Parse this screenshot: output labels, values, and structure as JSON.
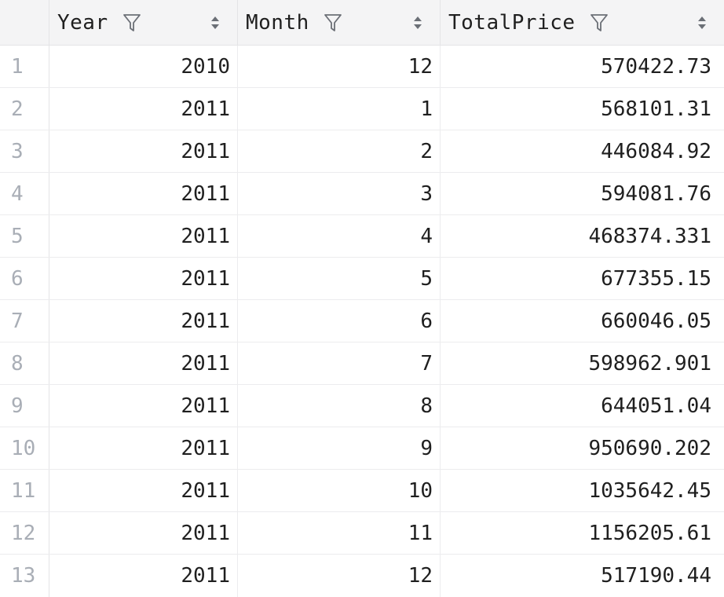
{
  "columns": [
    {
      "label": "Year"
    },
    {
      "label": "Month"
    },
    {
      "label": "TotalPrice"
    }
  ],
  "rows": [
    {
      "n": "1",
      "year": "2010",
      "month": "12",
      "total": "570422.73"
    },
    {
      "n": "2",
      "year": "2011",
      "month": "1",
      "total": "568101.31"
    },
    {
      "n": "3",
      "year": "2011",
      "month": "2",
      "total": "446084.92"
    },
    {
      "n": "4",
      "year": "2011",
      "month": "3",
      "total": "594081.76"
    },
    {
      "n": "5",
      "year": "2011",
      "month": "4",
      "total": "468374.331"
    },
    {
      "n": "6",
      "year": "2011",
      "month": "5",
      "total": "677355.15"
    },
    {
      "n": "7",
      "year": "2011",
      "month": "6",
      "total": "660046.05"
    },
    {
      "n": "8",
      "year": "2011",
      "month": "7",
      "total": "598962.901"
    },
    {
      "n": "9",
      "year": "2011",
      "month": "8",
      "total": "644051.04"
    },
    {
      "n": "10",
      "year": "2011",
      "month": "9",
      "total": "950690.202"
    },
    {
      "n": "11",
      "year": "2011",
      "month": "10",
      "total": "1035642.45"
    },
    {
      "n": "12",
      "year": "2011",
      "month": "11",
      "total": "1156205.61"
    },
    {
      "n": "13",
      "year": "2011",
      "month": "12",
      "total": "517190.44"
    }
  ]
}
